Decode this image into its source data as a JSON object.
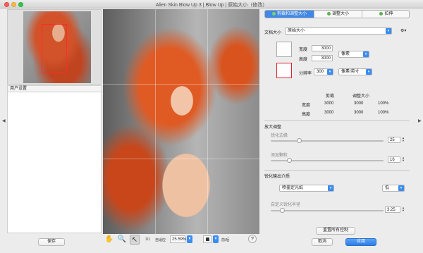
{
  "window": {
    "title": "Alien Skin Blow Up 3 | Blow Up | 原始大小（修改）"
  },
  "left_panel": {
    "preset_header": "用户设置",
    "save_label": "保存"
  },
  "toolbar": {
    "hand_icon": "hand-icon",
    "zoom_icon": "magnifier-icon",
    "select_icon": "pointer-icon",
    "ratio_label": "1/1",
    "fit_label": "自适应",
    "zoom_value": "25.59%",
    "preview_label": "前/后",
    "help_label": "?"
  },
  "right_panel": {
    "tabs": [
      {
        "label": "剪裁和调整大小"
      },
      {
        "label": "调整大小"
      },
      {
        "label": "拉伸"
      }
    ],
    "document_size_label": "文档大小",
    "document_size_value": "原始大小",
    "width_label": "宽度",
    "width_value": "3000",
    "height_label": "高度",
    "height_value": "3000",
    "unit_value": "像素",
    "resolution_label": "分辨率",
    "resolution_value": "300",
    "resolution_unit": "像素/英寸",
    "table": {
      "col_crop": "剪裁",
      "col_resize": "调整大小",
      "rows": [
        {
          "label": "宽度",
          "crop": "3000",
          "resize": "3000",
          "pct": "100%"
        },
        {
          "label": "高度",
          "crop": "3000",
          "resize": "3000",
          "pct": "100%"
        }
      ]
    },
    "enlarge_section": "放大调整",
    "sharpen_label": "锐化边缘",
    "sharpen_value": "25",
    "sharpen_fraction": 0.25,
    "grain_label": "添加颗粒",
    "grain_value": "16",
    "grain_fraction": 0.16,
    "output_section": "锐化输出介质",
    "output_select": "喷墨定光纸",
    "output_level": "低",
    "output_radius_label": "自定义锐化半径",
    "output_radius_value": "3.25",
    "output_radius_fraction": 0.1,
    "reset_label": "重置所有控制",
    "cancel_label": "取消",
    "apply_label": "应用"
  },
  "colors": {
    "accent": "#3f88e6",
    "nav_frame": "#ff2a2a"
  }
}
